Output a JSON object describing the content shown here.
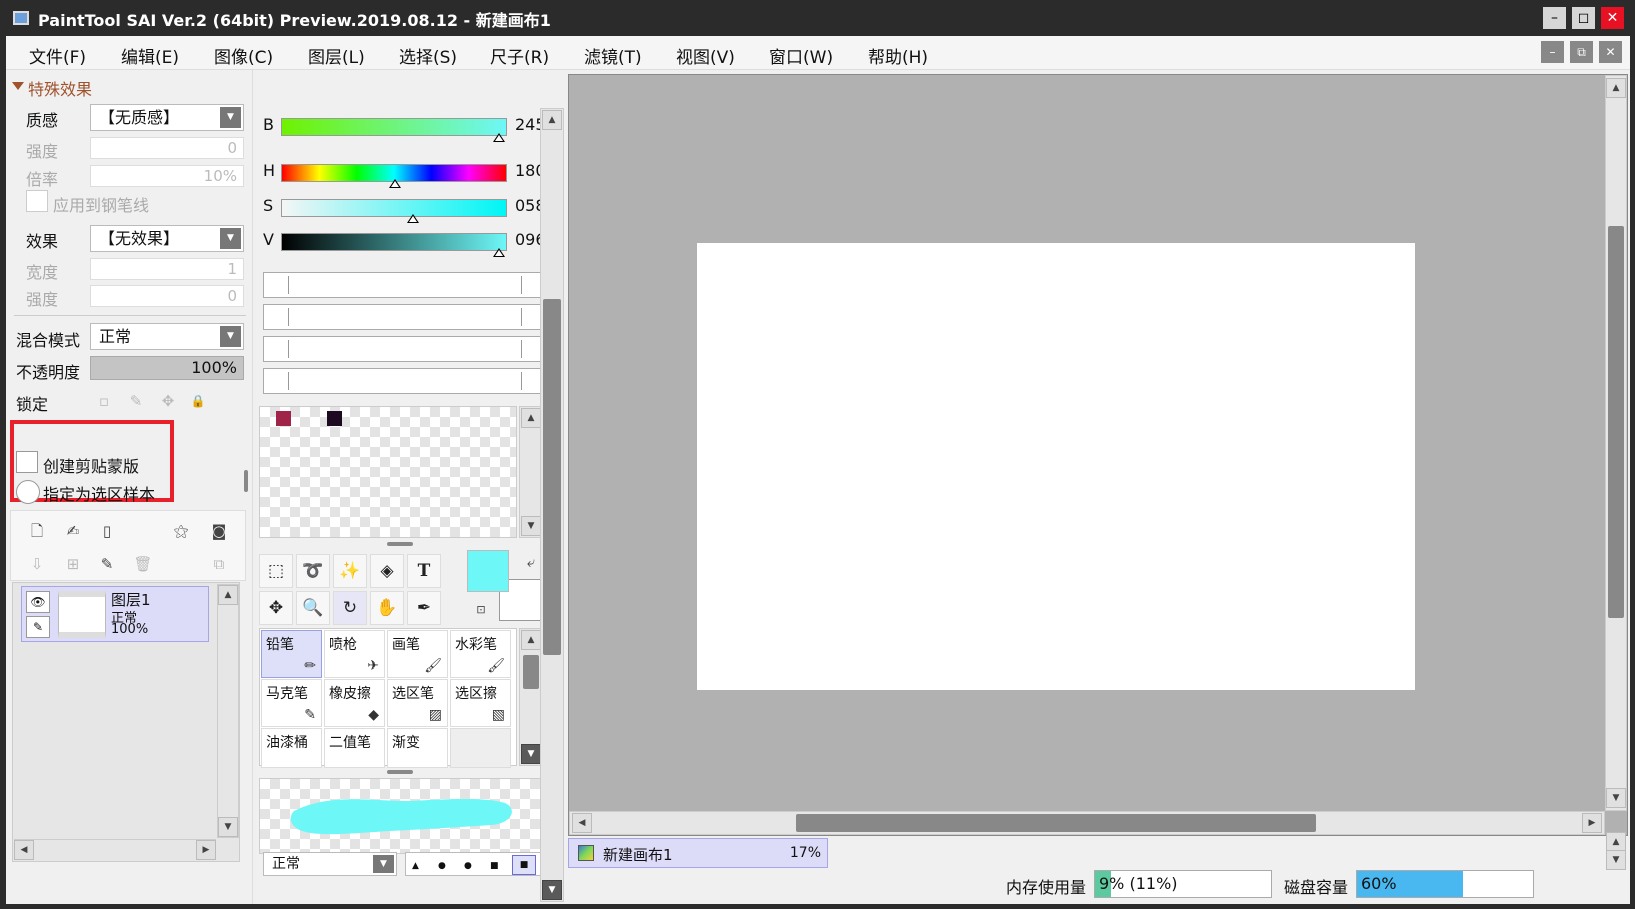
{
  "window": {
    "title": "PaintTool SAI Ver.2 (64bit) Preview.2019.08.12 - 新建画布1",
    "controls": {
      "minimize": "–",
      "maximize": "◻",
      "close": "✕"
    }
  },
  "menu": {
    "items": [
      "文件(F)",
      "编辑(E)",
      "图像(C)",
      "图层(L)",
      "选择(S)",
      "尺子(R)",
      "滤镜(T)",
      "视图(V)",
      "窗口(W)",
      "帮助(H)"
    ],
    "mdi": {
      "minimize": "–",
      "restore": "⧉",
      "close": "✕"
    }
  },
  "effects": {
    "header": "特殊效果",
    "texture_label": "质感",
    "texture_value": "【无质感】",
    "strength_label": "强度",
    "strength_value": "0",
    "scale_label": "倍率",
    "scale_value": "10%",
    "apply_pen_label": "应用到钢笔线",
    "effect_label": "效果",
    "effect_value": "【无效果】",
    "width_label": "宽度",
    "width_value": "1",
    "strength2_label": "强度",
    "strength2_value": "0"
  },
  "layer_props": {
    "blend_label": "混合模式",
    "blend_value": "正常",
    "opacity_label": "不透明度",
    "opacity_value": "100%",
    "opacity_fill": 1.0,
    "lock_label": "锁定",
    "clip_label": "创建剪贴蒙版",
    "sample_label": "指定为选区样本"
  },
  "layers": [
    {
      "name": "图层1",
      "mode": "正常",
      "opacity": "100%"
    }
  ],
  "color": {
    "b_label": "B",
    "b_value": "245",
    "b_pos": 0.96,
    "h_label": "H",
    "h_value": "180",
    "h_pos": 0.5,
    "s_label": "S",
    "s_value": "058",
    "s_pos": 0.58,
    "v_label": "V",
    "v_value": "096",
    "v_pos": 0.96,
    "swatches": [
      "#a0244a",
      "#1e0a20"
    ],
    "primary": "#6ef7f7",
    "secondary": "#ffffff"
  },
  "tools": {
    "text_tool": "T"
  },
  "brushes": [
    {
      "name": "铅笔",
      "icon": "pencil-icon",
      "glyph": "✏"
    },
    {
      "name": "喷枪",
      "icon": "airbrush-icon",
      "glyph": "✈"
    },
    {
      "name": "画笔",
      "icon": "brush-icon",
      "glyph": "🖌"
    },
    {
      "name": "水彩笔",
      "icon": "watercolor-icon",
      "glyph": "🖌"
    },
    {
      "name": "马克笔",
      "icon": "marker-icon",
      "glyph": "✎"
    },
    {
      "name": "橡皮擦",
      "icon": "eraser-icon",
      "glyph": "◆"
    },
    {
      "name": "选区笔",
      "icon": "select-pen-icon",
      "glyph": "▨"
    },
    {
      "name": "选区擦",
      "icon": "select-eraser-icon",
      "glyph": "▧"
    },
    {
      "name": "油漆桶",
      "icon": "",
      "glyph": ""
    },
    {
      "name": "二值笔",
      "icon": "",
      "glyph": ""
    },
    {
      "name": "渐变",
      "icon": "",
      "glyph": ""
    },
    {
      "name": "",
      "icon": "",
      "glyph": ""
    }
  ],
  "brush_mode": "正常",
  "canvas": {
    "tab_name": "新建画布1",
    "tab_zoom": "17%"
  },
  "status": {
    "memory_label": "内存使用量",
    "memory_value": "9% (11%)",
    "memory_fill": 0.09,
    "disk_label": "磁盘容量",
    "disk_value": "60%",
    "disk_fill": 0.6
  }
}
